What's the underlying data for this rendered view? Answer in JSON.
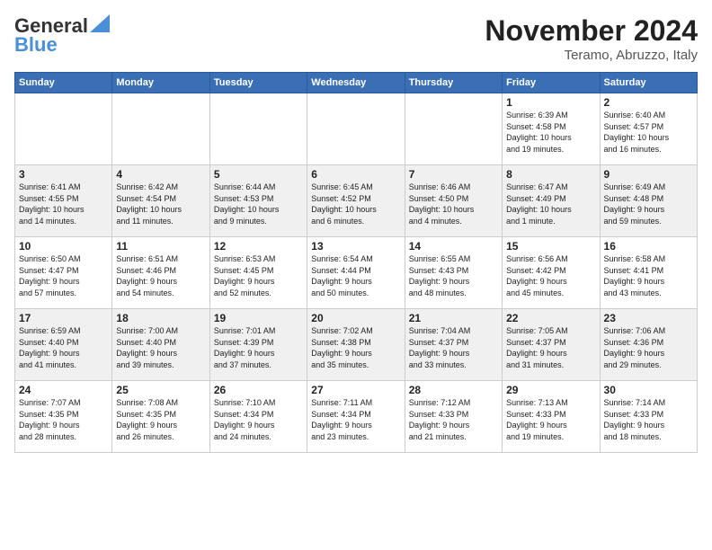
{
  "header": {
    "logo_line1": "General",
    "logo_line2": "Blue",
    "month": "November 2024",
    "location": "Teramo, Abruzzo, Italy"
  },
  "weekdays": [
    "Sunday",
    "Monday",
    "Tuesday",
    "Wednesday",
    "Thursday",
    "Friday",
    "Saturday"
  ],
  "weeks": [
    [
      {
        "day": "",
        "info": ""
      },
      {
        "day": "",
        "info": ""
      },
      {
        "day": "",
        "info": ""
      },
      {
        "day": "",
        "info": ""
      },
      {
        "day": "",
        "info": ""
      },
      {
        "day": "1",
        "info": "Sunrise: 6:39 AM\nSunset: 4:58 PM\nDaylight: 10 hours\nand 19 minutes."
      },
      {
        "day": "2",
        "info": "Sunrise: 6:40 AM\nSunset: 4:57 PM\nDaylight: 10 hours\nand 16 minutes."
      }
    ],
    [
      {
        "day": "3",
        "info": "Sunrise: 6:41 AM\nSunset: 4:55 PM\nDaylight: 10 hours\nand 14 minutes."
      },
      {
        "day": "4",
        "info": "Sunrise: 6:42 AM\nSunset: 4:54 PM\nDaylight: 10 hours\nand 11 minutes."
      },
      {
        "day": "5",
        "info": "Sunrise: 6:44 AM\nSunset: 4:53 PM\nDaylight: 10 hours\nand 9 minutes."
      },
      {
        "day": "6",
        "info": "Sunrise: 6:45 AM\nSunset: 4:52 PM\nDaylight: 10 hours\nand 6 minutes."
      },
      {
        "day": "7",
        "info": "Sunrise: 6:46 AM\nSunset: 4:50 PM\nDaylight: 10 hours\nand 4 minutes."
      },
      {
        "day": "8",
        "info": "Sunrise: 6:47 AM\nSunset: 4:49 PM\nDaylight: 10 hours\nand 1 minute."
      },
      {
        "day": "9",
        "info": "Sunrise: 6:49 AM\nSunset: 4:48 PM\nDaylight: 9 hours\nand 59 minutes."
      }
    ],
    [
      {
        "day": "10",
        "info": "Sunrise: 6:50 AM\nSunset: 4:47 PM\nDaylight: 9 hours\nand 57 minutes."
      },
      {
        "day": "11",
        "info": "Sunrise: 6:51 AM\nSunset: 4:46 PM\nDaylight: 9 hours\nand 54 minutes."
      },
      {
        "day": "12",
        "info": "Sunrise: 6:53 AM\nSunset: 4:45 PM\nDaylight: 9 hours\nand 52 minutes."
      },
      {
        "day": "13",
        "info": "Sunrise: 6:54 AM\nSunset: 4:44 PM\nDaylight: 9 hours\nand 50 minutes."
      },
      {
        "day": "14",
        "info": "Sunrise: 6:55 AM\nSunset: 4:43 PM\nDaylight: 9 hours\nand 48 minutes."
      },
      {
        "day": "15",
        "info": "Sunrise: 6:56 AM\nSunset: 4:42 PM\nDaylight: 9 hours\nand 45 minutes."
      },
      {
        "day": "16",
        "info": "Sunrise: 6:58 AM\nSunset: 4:41 PM\nDaylight: 9 hours\nand 43 minutes."
      }
    ],
    [
      {
        "day": "17",
        "info": "Sunrise: 6:59 AM\nSunset: 4:40 PM\nDaylight: 9 hours\nand 41 minutes."
      },
      {
        "day": "18",
        "info": "Sunrise: 7:00 AM\nSunset: 4:40 PM\nDaylight: 9 hours\nand 39 minutes."
      },
      {
        "day": "19",
        "info": "Sunrise: 7:01 AM\nSunset: 4:39 PM\nDaylight: 9 hours\nand 37 minutes."
      },
      {
        "day": "20",
        "info": "Sunrise: 7:02 AM\nSunset: 4:38 PM\nDaylight: 9 hours\nand 35 minutes."
      },
      {
        "day": "21",
        "info": "Sunrise: 7:04 AM\nSunset: 4:37 PM\nDaylight: 9 hours\nand 33 minutes."
      },
      {
        "day": "22",
        "info": "Sunrise: 7:05 AM\nSunset: 4:37 PM\nDaylight: 9 hours\nand 31 minutes."
      },
      {
        "day": "23",
        "info": "Sunrise: 7:06 AM\nSunset: 4:36 PM\nDaylight: 9 hours\nand 29 minutes."
      }
    ],
    [
      {
        "day": "24",
        "info": "Sunrise: 7:07 AM\nSunset: 4:35 PM\nDaylight: 9 hours\nand 28 minutes."
      },
      {
        "day": "25",
        "info": "Sunrise: 7:08 AM\nSunset: 4:35 PM\nDaylight: 9 hours\nand 26 minutes."
      },
      {
        "day": "26",
        "info": "Sunrise: 7:10 AM\nSunset: 4:34 PM\nDaylight: 9 hours\nand 24 minutes."
      },
      {
        "day": "27",
        "info": "Sunrise: 7:11 AM\nSunset: 4:34 PM\nDaylight: 9 hours\nand 23 minutes."
      },
      {
        "day": "28",
        "info": "Sunrise: 7:12 AM\nSunset: 4:33 PM\nDaylight: 9 hours\nand 21 minutes."
      },
      {
        "day": "29",
        "info": "Sunrise: 7:13 AM\nSunset: 4:33 PM\nDaylight: 9 hours\nand 19 minutes."
      },
      {
        "day": "30",
        "info": "Sunrise: 7:14 AM\nSunset: 4:33 PM\nDaylight: 9 hours\nand 18 minutes."
      }
    ]
  ]
}
